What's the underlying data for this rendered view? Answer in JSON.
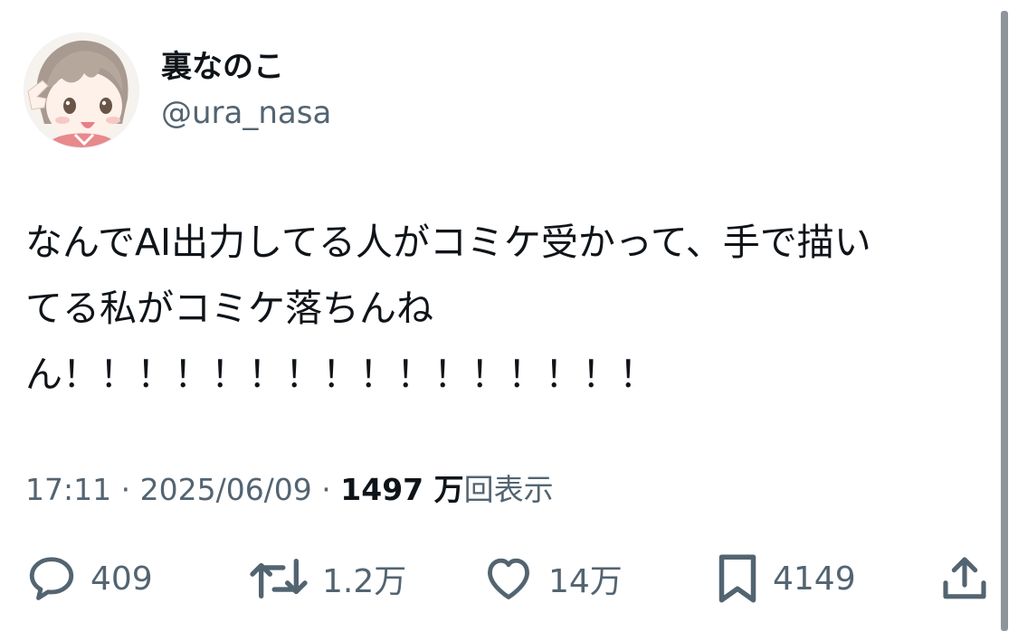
{
  "user": {
    "display_name": "裏なのこ",
    "handle": "@ura_nasa",
    "avatar_icon": "avatar-illustration-icon"
  },
  "tweet": {
    "lines": [
      "なんでAI出力してる人がコミケ受かって、手で描い",
      "てる私がコミケ落ちんね",
      "ん！！！！！！！！！！！！！！！！"
    ]
  },
  "meta": {
    "time": "17:11",
    "separator": " · ",
    "date": "2025/06/09",
    "views_count": "1497 万",
    "views_label": "回表示"
  },
  "actions": {
    "reply": {
      "icon": "reply-icon",
      "count": "409"
    },
    "repost": {
      "icon": "repost-icon",
      "count": "1.2万"
    },
    "like": {
      "icon": "heart-icon",
      "count": "14万"
    },
    "bookmark": {
      "icon": "bookmark-icon",
      "count": "4149"
    },
    "share": {
      "icon": "share-icon"
    }
  },
  "colors": {
    "text_primary": "#0f1419",
    "text_secondary": "#536471",
    "scrollbar": "#8e949a"
  }
}
